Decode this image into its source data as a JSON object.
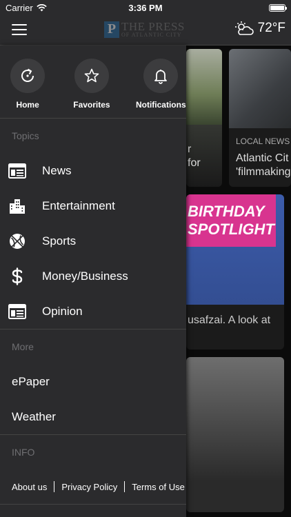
{
  "status_bar": {
    "carrier": "Carrier",
    "time": "3:36 PM",
    "battery_level": 1.0
  },
  "header": {
    "logo_mark": "P",
    "logo_main": "THE PRESS",
    "logo_sub": "OF ATLANTIC CITY",
    "weather_icon": "partly-cloudy-icon",
    "temperature": "72°F"
  },
  "drawer": {
    "quick_links": [
      {
        "label": "Home",
        "icon": "refresh-home-icon"
      },
      {
        "label": "Favorites",
        "icon": "star-icon"
      },
      {
        "label": "Notifications",
        "icon": "bell-icon"
      }
    ],
    "topics_title": "Topics",
    "topics": [
      {
        "label": "News",
        "icon": "newspaper-icon"
      },
      {
        "label": "Entertainment",
        "icon": "city-buildings-icon"
      },
      {
        "label": "Sports",
        "icon": "basketball-icon"
      },
      {
        "label": "Money/Business",
        "icon": "dollar-icon"
      },
      {
        "label": "Opinion",
        "icon": "newspaper-icon"
      }
    ],
    "more_title": "More",
    "more": [
      {
        "label": "ePaper"
      },
      {
        "label": "Weather"
      }
    ],
    "info_title": "INFO",
    "info_links": [
      {
        "label": "About us"
      },
      {
        "label": "Privacy Policy"
      },
      {
        "label": "Terms of Use"
      }
    ]
  },
  "feed": {
    "card1_text": "r\nfor",
    "card2_kicker": "LOCAL NEWS",
    "card2_headline": "Atlantic Cit\n'filmmaking",
    "card3_banner": "BIRTHDAY\nSPOTLIGHT",
    "card3_text": "usafzai. A look at"
  },
  "colors": {
    "background": "#2b2b2d",
    "accent": "#1f6aa5",
    "banner": "#d8348f"
  }
}
